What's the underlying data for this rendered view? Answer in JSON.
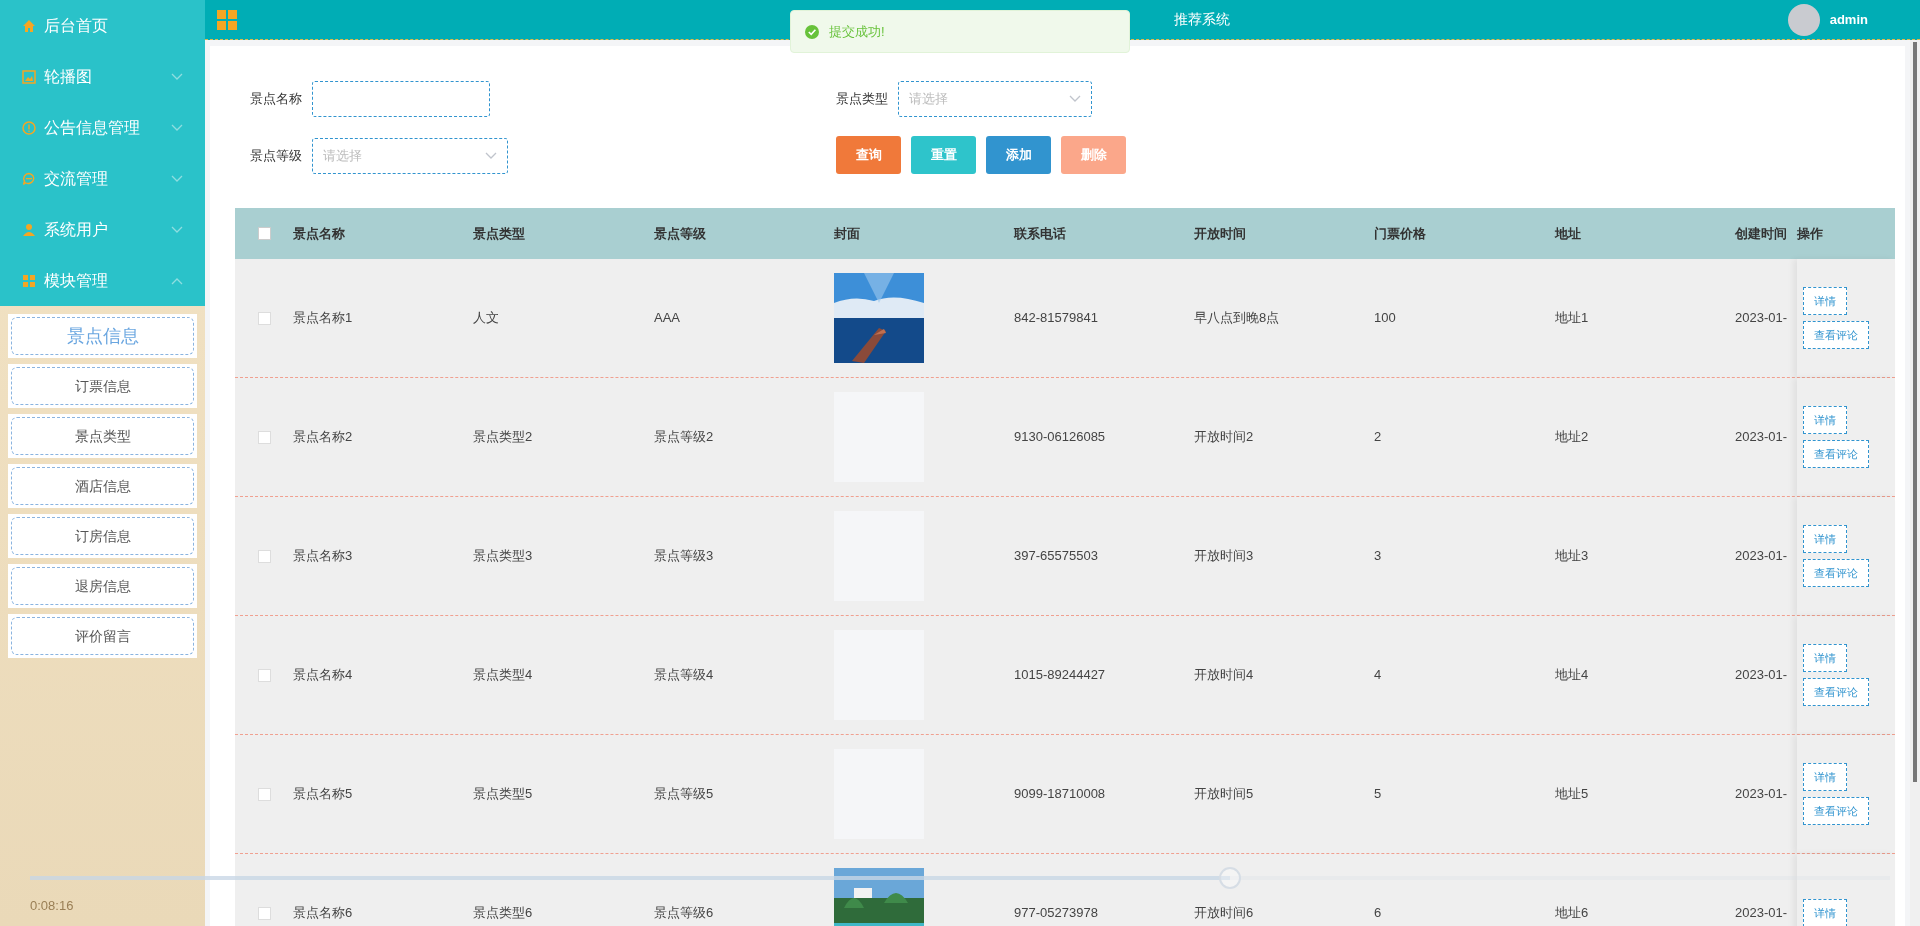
{
  "topbar": {
    "title": "推荐系统",
    "user": "admin"
  },
  "toast": {
    "message": "提交成功!"
  },
  "sidebar": {
    "items": [
      {
        "label": "后台首页",
        "kind": "link"
      },
      {
        "label": "轮播图",
        "kind": "group",
        "expanded": false
      },
      {
        "label": "公告信息管理",
        "kind": "group",
        "expanded": false
      },
      {
        "label": "交流管理",
        "kind": "group",
        "expanded": false
      },
      {
        "label": "系统用户",
        "kind": "group",
        "expanded": false
      },
      {
        "label": "模块管理",
        "kind": "group",
        "expanded": true
      }
    ],
    "submenu": [
      {
        "label": "景点信息",
        "selected": true
      },
      {
        "label": "订票信息",
        "selected": false
      },
      {
        "label": "景点类型",
        "selected": false
      },
      {
        "label": "酒店信息",
        "selected": false
      },
      {
        "label": "订房信息",
        "selected": false
      },
      {
        "label": "退房信息",
        "selected": false
      },
      {
        "label": "评价留言",
        "selected": false
      }
    ]
  },
  "filters": [
    {
      "label": "景点名称",
      "kind": "input"
    },
    {
      "label": "景点类型",
      "kind": "select",
      "placeholder": "请选择"
    },
    {
      "label": "景点等级",
      "kind": "select",
      "placeholder": "请选择"
    }
  ],
  "buttons": [
    {
      "label": "查询",
      "kind": "query"
    },
    {
      "label": "重置",
      "kind": "reset"
    },
    {
      "label": "添加",
      "kind": "add"
    },
    {
      "label": "删除",
      "kind": "delete"
    }
  ],
  "table": {
    "all_checked": false,
    "columns": [
      "景点名称",
      "景点类型",
      "景点等级",
      "封面",
      "联系电话",
      "开放时间",
      "门票价格",
      "地址",
      "创建时间",
      "操作"
    ],
    "rows": [
      {
        "checked": false,
        "name": "景点名称1",
        "type": "人文",
        "level": "AAA",
        "cover": {
          "kind": "picture"
        },
        "phone": "842-81579841",
        "open": "早八点到晚8点",
        "price": "100",
        "address": "地址1",
        "created": "2023-01-",
        "actions": [
          "详情",
          "查看评论"
        ]
      },
      {
        "checked": false,
        "name": "景点名称2",
        "type": "景点类型2",
        "level": "景点等级2",
        "cover": {
          "kind": "empty"
        },
        "phone": "9130-06126085",
        "open": "开放时间2",
        "price": "2",
        "address": "地址2",
        "created": "2023-01-",
        "actions": [
          "详情",
          "查看评论"
        ]
      },
      {
        "checked": false,
        "name": "景点名称3",
        "type": "景点类型3",
        "level": "景点等级3",
        "cover": {
          "kind": "empty"
        },
        "phone": "397-65575503",
        "open": "开放时间3",
        "price": "3",
        "address": "地址3",
        "created": "2023-01-",
        "actions": [
          "详情",
          "查看评论"
        ]
      },
      {
        "checked": false,
        "name": "景点名称4",
        "type": "景点类型4",
        "level": "景点等级4",
        "cover": {
          "kind": "empty"
        },
        "phone": "1015-89244427",
        "open": "开放时间4",
        "price": "4",
        "address": "地址4",
        "created": "2023-01-",
        "actions": [
          "详情",
          "查看评论"
        ]
      },
      {
        "checked": false,
        "name": "景点名称5",
        "type": "景点类型5",
        "level": "景点等级5",
        "cover": {
          "kind": "empty"
        },
        "phone": "9099-18710008",
        "open": "开放时间5",
        "price": "5",
        "address": "地址5",
        "created": "2023-01-",
        "actions": [
          "详情",
          "查看评论"
        ]
      },
      {
        "checked": false,
        "name": "景点名称6",
        "type": "景点类型6",
        "level": "景点等级6",
        "cover": {
          "kind": "picture"
        },
        "phone": "977-05273978",
        "open": "开放时间6",
        "price": "6",
        "address": "地址6",
        "created": "2023-01-",
        "actions": [
          "详情"
        ]
      }
    ]
  },
  "player": {
    "level": 0.645,
    "time": "0:08:16"
  }
}
